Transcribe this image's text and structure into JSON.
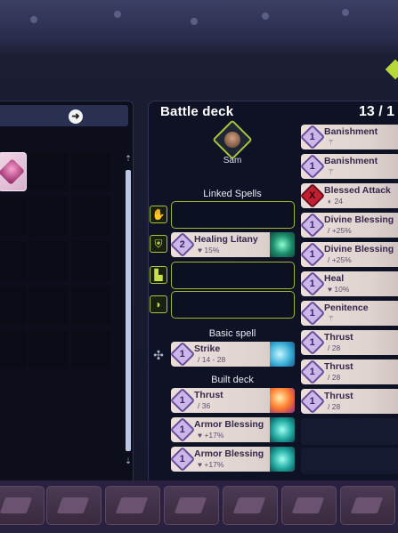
{
  "deck": {
    "title": "Battle deck",
    "count": "13 / 1",
    "character_name": "Sam"
  },
  "sections": {
    "linked_spells": "Linked Spells",
    "basic_spell": "Basic spell",
    "built_deck": "Built deck"
  },
  "linked_spells": [
    {
      "slot": "empty",
      "icon": "gauntlets-icon"
    },
    {
      "slot": "card",
      "icon": "armor-icon",
      "cost": "2",
      "name": "Healing Litany",
      "stat": "♥ 15%",
      "art": "green"
    },
    {
      "slot": "empty",
      "icon": "boots-icon"
    },
    {
      "slot": "empty",
      "icon": "helmet-icon"
    }
  ],
  "basic_spell": {
    "cost": "1",
    "name": "Strike",
    "stat": "/ 14 - 28",
    "art": "blue",
    "icon": "sword-icon"
  },
  "built_deck": [
    {
      "cost": "1",
      "name": "Thrust",
      "stat": "/ 36",
      "art": "fire"
    },
    {
      "cost": "1",
      "name": "Armor Blessing",
      "stat": "♥ +17%",
      "art": "cyan"
    },
    {
      "cost": "1",
      "name": "Armor Blessing",
      "stat": "♥ +17%",
      "art": "cyan"
    }
  ],
  "right_cards": [
    {
      "cost": "1",
      "name": "Banishment",
      "stat": "⚚"
    },
    {
      "cost": "1",
      "name": "Banishment",
      "stat": "⚚"
    },
    {
      "cost": "X",
      "name": "Blessed Attack",
      "stat": "◐ 24",
      "red": true
    },
    {
      "cost": "1",
      "name": "Divine Blessing",
      "stat": "/ +25%"
    },
    {
      "cost": "1",
      "name": "Divine Blessing",
      "stat": "/ +25%"
    },
    {
      "cost": "1",
      "name": "Heal",
      "stat": "♥ 10%"
    },
    {
      "cost": "1",
      "name": "Penitence",
      "stat": "⚚"
    },
    {
      "cost": "1",
      "name": "Thrust",
      "stat": "/ 28"
    },
    {
      "cost": "1",
      "name": "Thrust",
      "stat": "/ 28"
    },
    {
      "cost": "1",
      "name": "Thrust",
      "stat": "/ 28"
    }
  ],
  "left_panel": {
    "arrow_icon": "arrow-right-icon"
  },
  "colors": {
    "accent_green": "#a7c43a",
    "panel": "#0f1225",
    "card": "#eadfda",
    "cost_gem": "#c9b8e8",
    "red_gem": "#c22030"
  }
}
